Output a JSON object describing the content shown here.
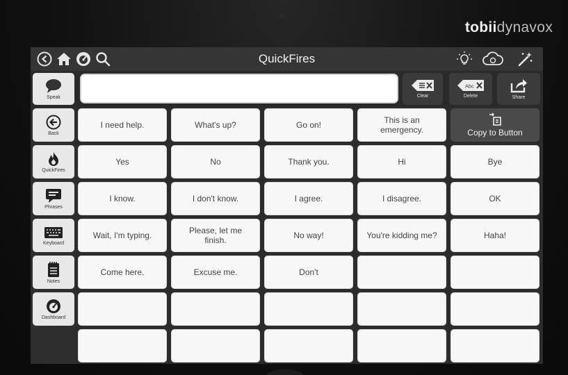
{
  "device": {
    "brand_bold": "tobii",
    "brand_light": "dynavox"
  },
  "topbar": {
    "title": "QuickFires",
    "icons": [
      "back-arrow-icon",
      "home-icon",
      "dashboard-icon",
      "search-icon",
      "lightbulb-icon",
      "cloud-sync-icon",
      "magic-wand-icon"
    ]
  },
  "message_bar": {
    "speak_label": "Speak",
    "input_value": "",
    "clear_label": "Clear",
    "delete_label": "Delete",
    "delete_icon_text": "Abc",
    "share_label": "Share"
  },
  "sidebar": {
    "items": [
      {
        "label": "Back",
        "icon": "back-arrow-icon"
      },
      {
        "label": "QuickFires",
        "icon": "flame-icon"
      },
      {
        "label": "Phrases",
        "icon": "speech-bubble-icon"
      },
      {
        "label": "Keyboard",
        "icon": "keyboard-icon"
      },
      {
        "label": "Notes",
        "icon": "notepad-icon"
      },
      {
        "label": "Dashboard",
        "icon": "dashboard-icon"
      }
    ]
  },
  "grid": {
    "copy_to_button_label": "Copy to Button",
    "cells": [
      "I need help.",
      "What's up?",
      "Go on!",
      "This is an emergency.",
      "",
      "Yes",
      "No",
      "Thank you.",
      "Hi",
      "Bye",
      "I know.",
      "I don't know.",
      "I agree.",
      "I disagree.",
      "OK",
      "Wait, I'm typing.",
      "Please, let me finish.",
      "No way!",
      "You're kidding me?",
      "Haha!",
      "Come here.",
      "Excuse me.",
      "Don't",
      "",
      "",
      "",
      "",
      "",
      "",
      "",
      "",
      "",
      "",
      "",
      ""
    ]
  }
}
